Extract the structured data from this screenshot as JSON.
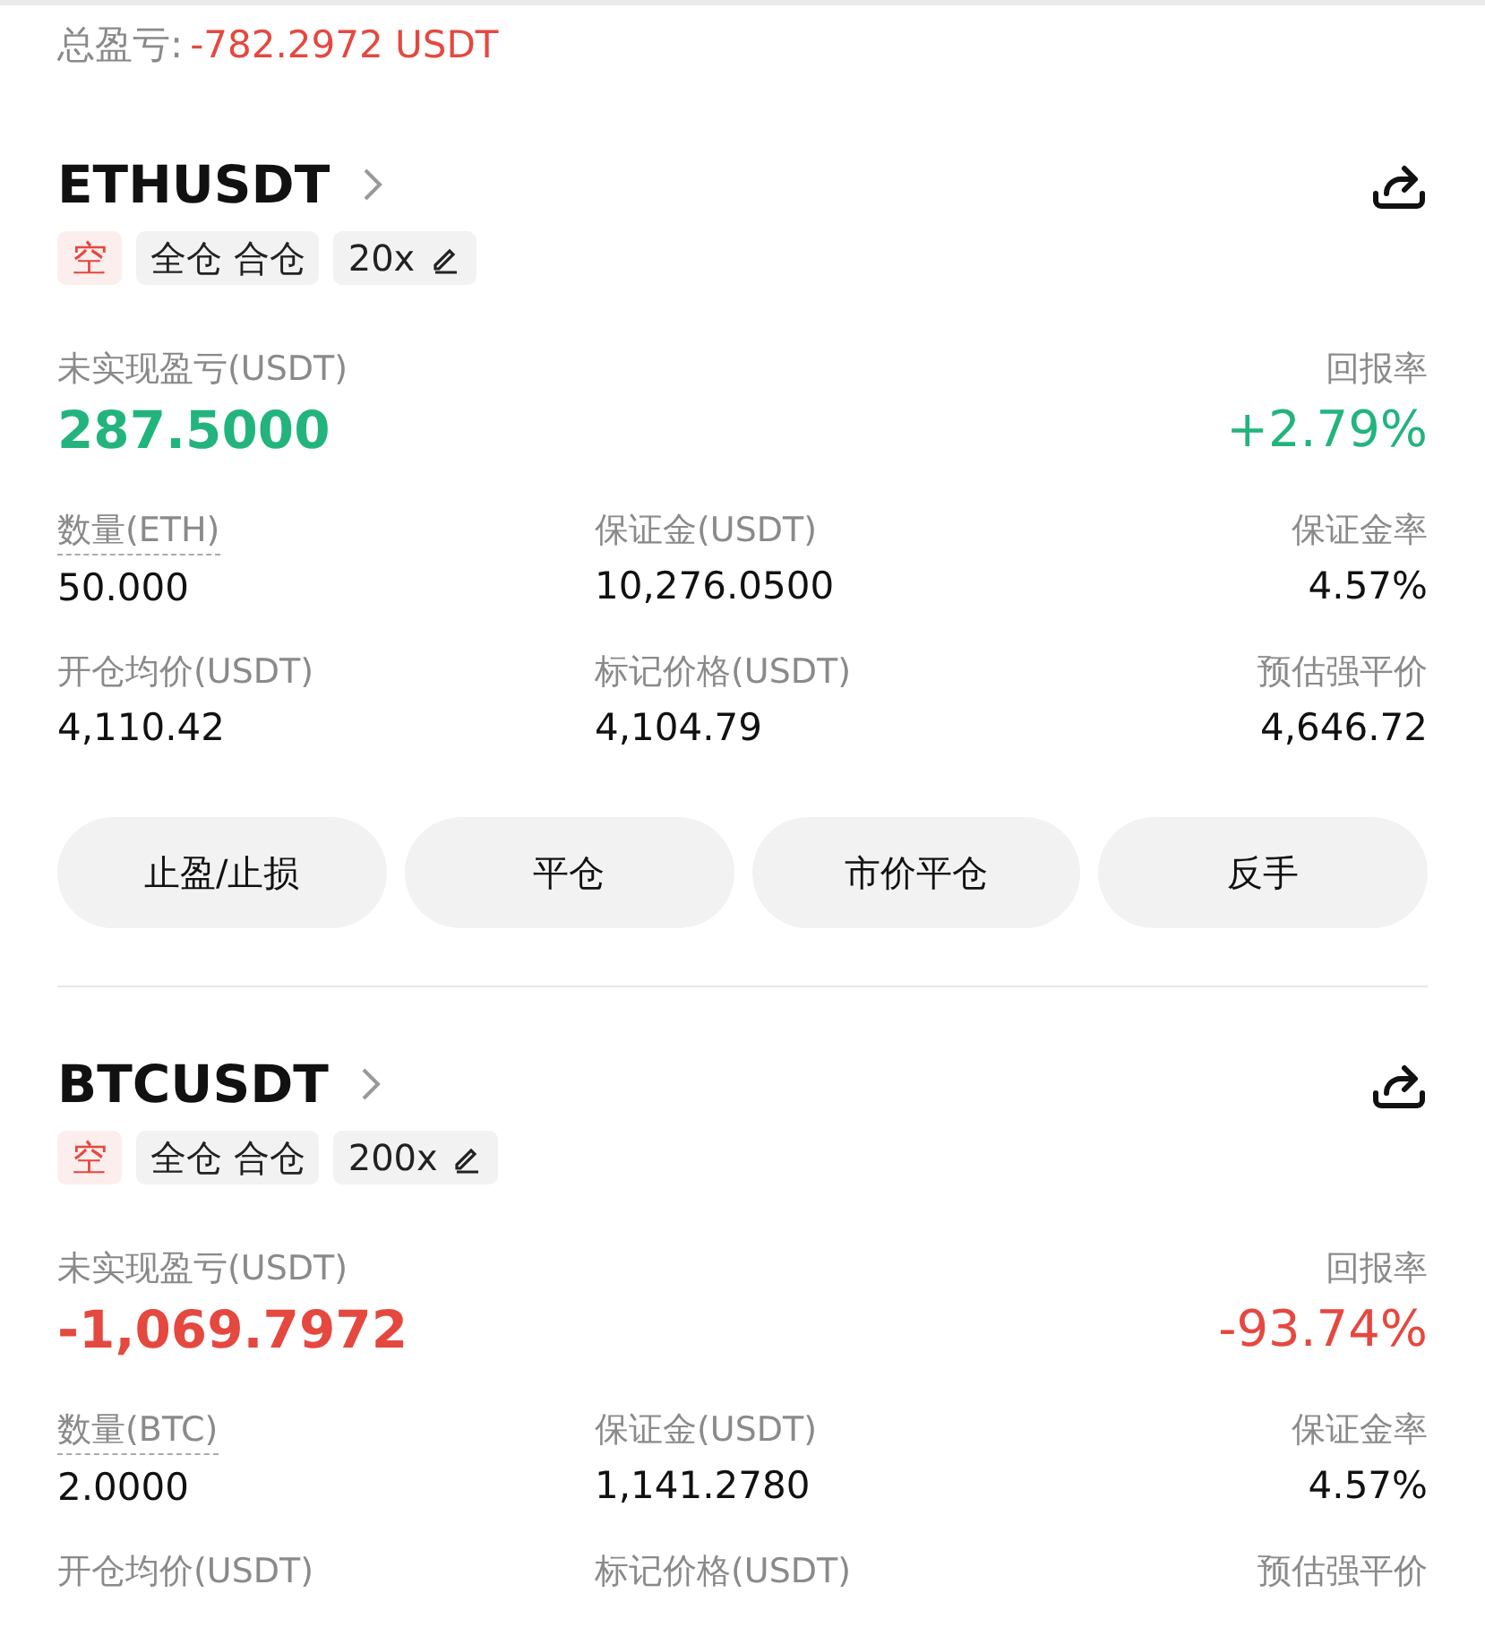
{
  "total_pnl": {
    "label": "总盈亏:",
    "value": "-782.2972 USDT",
    "color": "#e5483f"
  },
  "positions": [
    {
      "symbol": "ETHUSDT",
      "tags": [
        {
          "text": "空",
          "kind": "side"
        },
        {
          "text": "全仓 合仓",
          "kind": "mode"
        },
        {
          "text": "20x",
          "kind": "leverage"
        }
      ],
      "pnl_label": "未实现盈亏(USDT)",
      "pnl": "287.5000",
      "roe_label": "回报率",
      "roe": "+2.79%",
      "color": "#23b47e",
      "stats": [
        {
          "label": "数量(ETH)",
          "value": "50.000",
          "underlined": true
        },
        {
          "label": "保证金(USDT)",
          "value": "10,276.0500",
          "underlined": false
        },
        {
          "label": "保证金率",
          "value": "4.57%",
          "underlined": false
        },
        {
          "label": "开仓均价(USDT)",
          "value": "4,110.42",
          "underlined": false
        },
        {
          "label": "标记价格(USDT)",
          "value": "4,104.79",
          "underlined": false
        },
        {
          "label": "预估强平价",
          "value": "4,646.72",
          "underlined": false
        }
      ],
      "buttons": [
        "止盈/止损",
        "平仓",
        "市价平仓",
        "反手"
      ]
    },
    {
      "symbol": "BTCUSDT",
      "tags": [
        {
          "text": "空",
          "kind": "side"
        },
        {
          "text": "全仓 合仓",
          "kind": "mode"
        },
        {
          "text": "200x",
          "kind": "leverage"
        }
      ],
      "pnl_label": "未实现盈亏(USDT)",
      "pnl": "-1,069.7972",
      "roe_label": "回报率",
      "roe": "-93.74%",
      "color": "#e5483f",
      "stats": [
        {
          "label": "数量(BTC)",
          "value": "2.0000",
          "underlined": true
        },
        {
          "label": "保证金(USDT)",
          "value": "1,141.2780",
          "underlined": false
        },
        {
          "label": "保证金率",
          "value": "4.57%",
          "underlined": false
        },
        {
          "label": "开仓均价(USDT)",
          "underlined": false
        },
        {
          "label": "标记价格(USDT)",
          "underlined": false
        },
        {
          "label": "预估强平价",
          "underlined": false
        }
      ]
    }
  ]
}
